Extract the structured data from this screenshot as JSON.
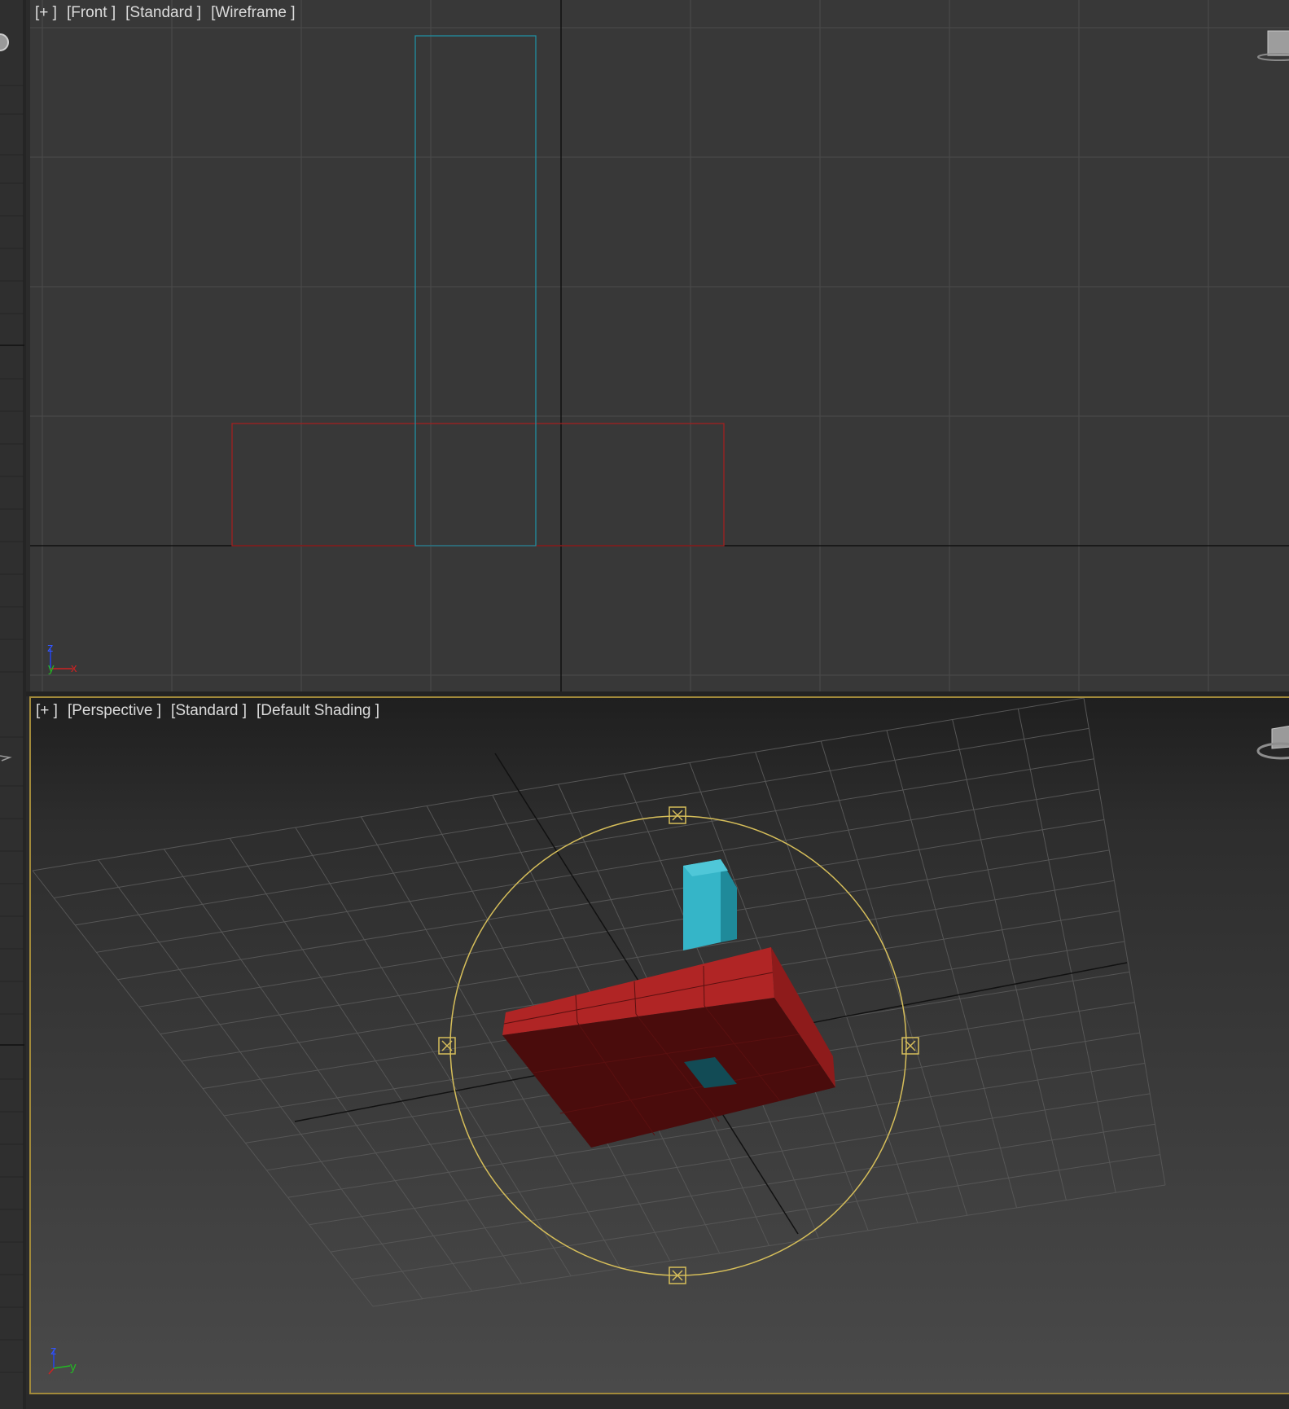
{
  "viewports": {
    "front": {
      "menu_label": "[+ ]",
      "view_label": "[Front ]",
      "mode_label": "[Standard ]",
      "shading_label": "[Wireframe ]"
    },
    "perspective": {
      "menu_label": "[+ ]",
      "view_label": "[Perspective ]",
      "mode_label": "[Standard ]",
      "shading_label": "[Default Shading ]"
    }
  },
  "axis_gizmo": {
    "z": "z",
    "x": "x",
    "y": "y"
  },
  "colors": {
    "plane_object": "#b22222",
    "box_object": "#2aa6b8",
    "selection_gizmo": "#d6be5a",
    "active_viewport_border": "#a28a3a",
    "grid": "#4a4a4a"
  },
  "icons": [
    "viewcube-icon",
    "steering-wheel-icon",
    "axis-tripod-icon"
  ]
}
